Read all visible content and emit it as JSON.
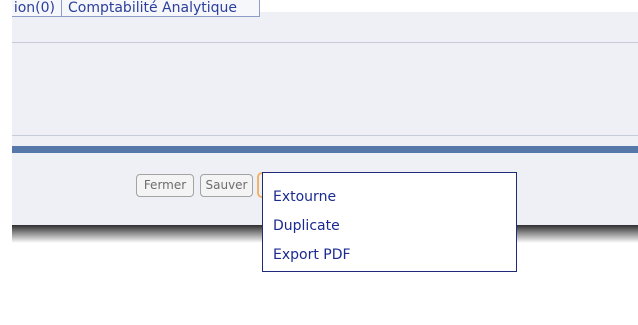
{
  "tabs": [
    {
      "label": "ion(0)"
    },
    {
      "label": "Comptabilité Analytique"
    }
  ],
  "footer": {
    "close_label": "Fermer",
    "save_label": "Sauver"
  },
  "dropdown": {
    "items": [
      {
        "label": "Extourne"
      },
      {
        "label": "Duplicate"
      },
      {
        "label": "Export PDF"
      }
    ]
  },
  "colors": {
    "accent_bar": "#5677a9",
    "link_text": "#1a2a8e",
    "active_button_border": "#f0b56a"
  }
}
